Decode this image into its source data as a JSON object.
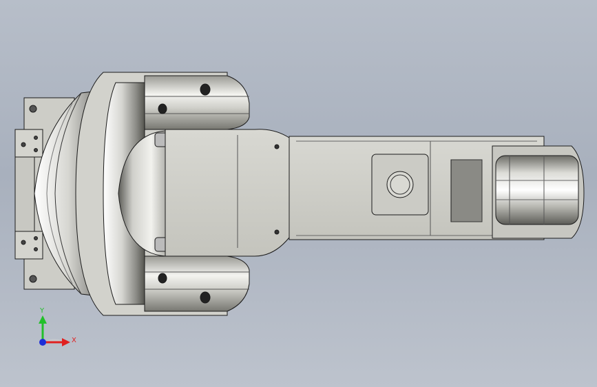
{
  "viewport": {
    "background_top": "#b7bec9",
    "background_bottom": "#bdc3cd"
  },
  "model": {
    "type": "robot-arm-link-top-view",
    "edge_color": "#1a1a1a",
    "body_light": "#e8e8e4",
    "body_mid": "#c9c9c3",
    "body_dark": "#6e6e6a"
  },
  "triad": {
    "y_label": "Y",
    "x_label": "X",
    "y_color": "#22c02a",
    "x_color": "#e02020",
    "z_color": "#1c2ed8"
  }
}
